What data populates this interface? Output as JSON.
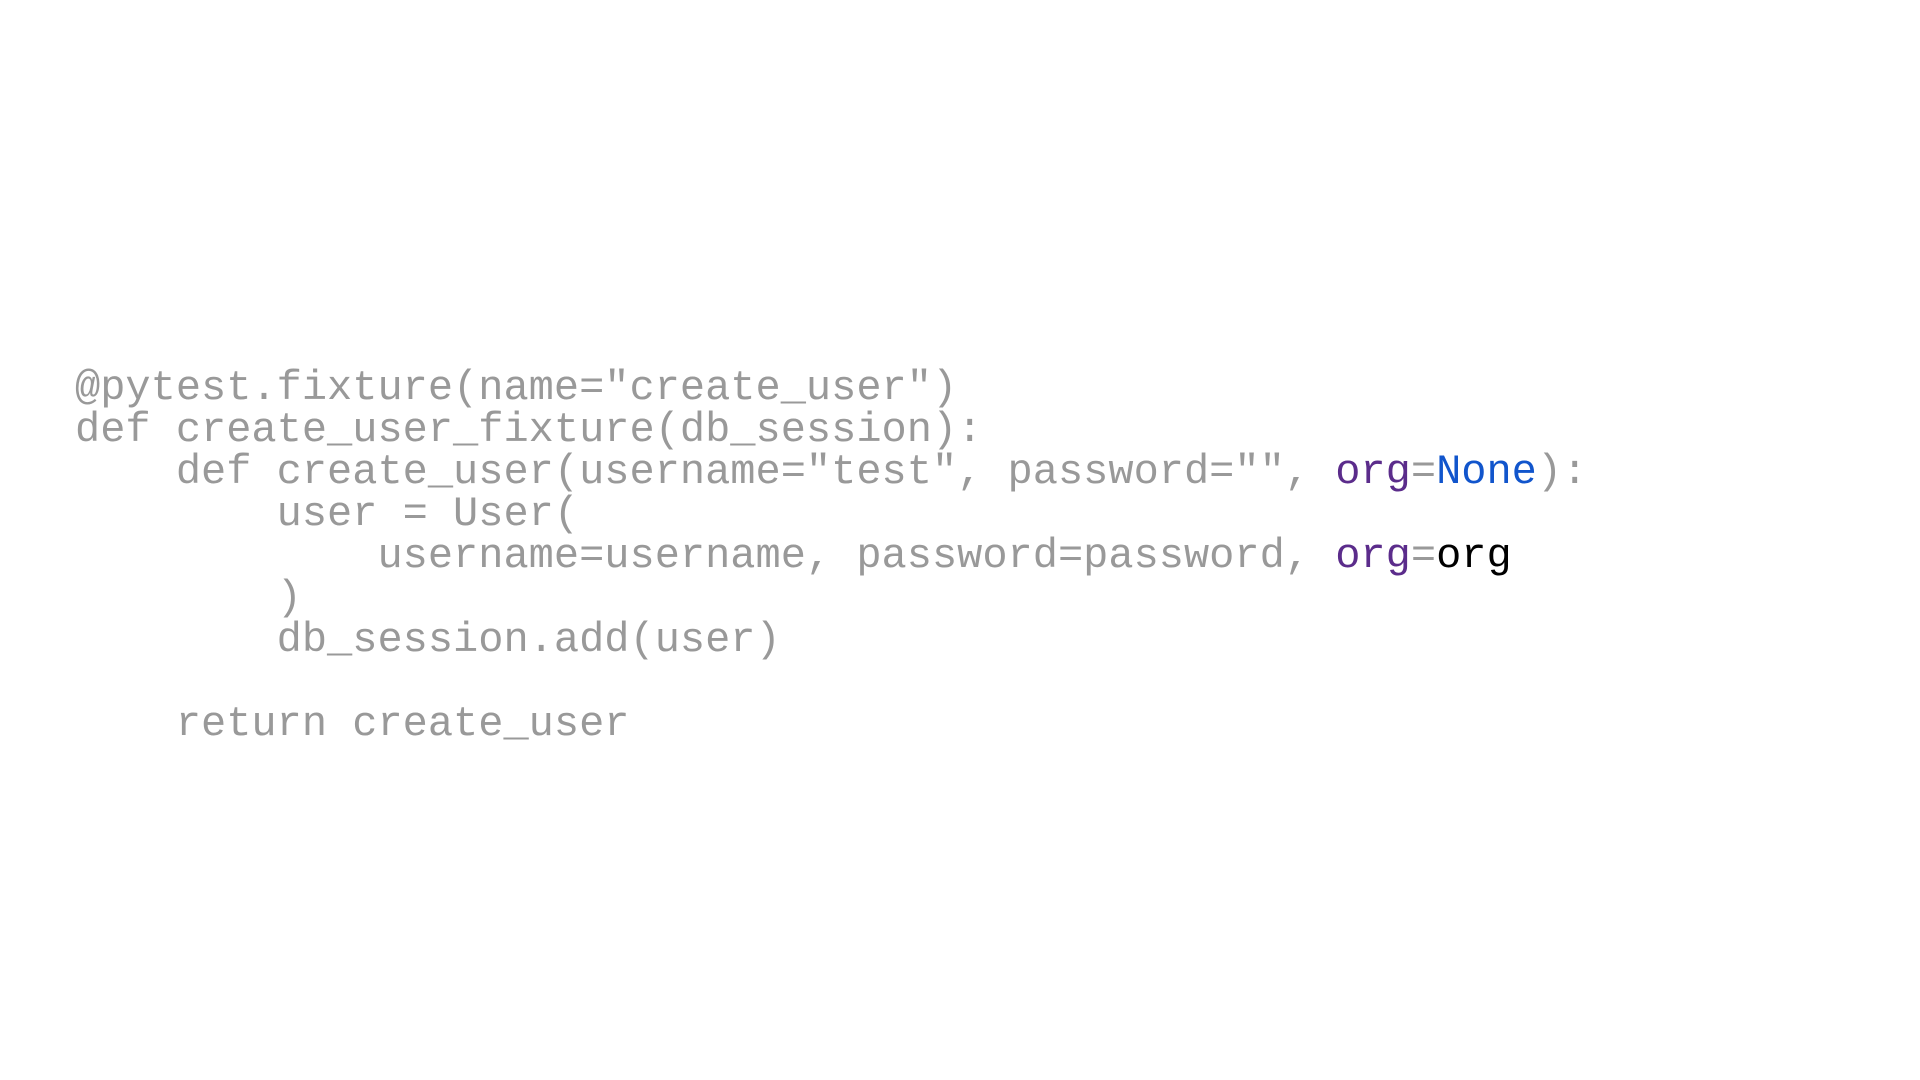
{
  "code": {
    "line1": "@pytest.fixture(name=\"create_user\")",
    "line2": "def create_user_fixture(db_session):",
    "line3_prefix": "    def create_user(username=\"test\", password=\"\", ",
    "line3_org_key": "org",
    "line3_equals": "=",
    "line3_none": "None",
    "line3_suffix": "):",
    "line4": "        user = User(",
    "line5_prefix": "            username=username, password=password, ",
    "line5_org_key": "org",
    "line5_equals": "=",
    "line5_org_val": "org",
    "line6": "        )",
    "line7": "        db_session.add(user)",
    "line8": "",
    "line9": "    return create_user"
  }
}
